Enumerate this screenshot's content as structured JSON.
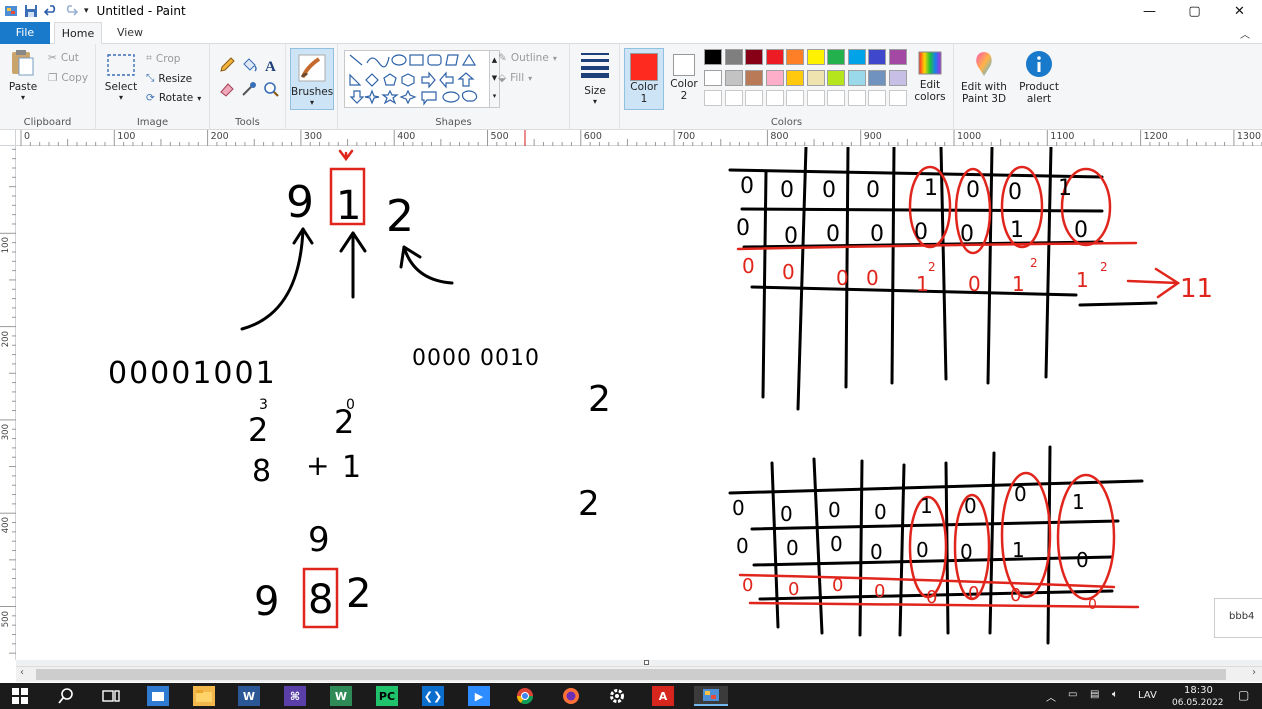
{
  "window": {
    "title": "Untitled - Paint",
    "buttons": [
      "—",
      "▢",
      "✕"
    ]
  },
  "tabs": {
    "file": "File",
    "home": "Home",
    "view": "View"
  },
  "ribbon": {
    "clipboard": {
      "paste": "Paste",
      "cut": "Cut",
      "copy": "Copy",
      "label": "Clipboard"
    },
    "image": {
      "select": "Select",
      "crop": "Crop",
      "resize": "Resize",
      "rotate": "Rotate",
      "label": "Image"
    },
    "tools": {
      "label": "Tools"
    },
    "brushes": {
      "label": "Brushes"
    },
    "shapes": {
      "outline": "Outline",
      "fill": "Fill",
      "label": "Shapes"
    },
    "size": {
      "label": "Size"
    },
    "colors": {
      "color1_label": "Color\n1",
      "color1_a": "Color",
      "color1_b": "1",
      "color2_a": "Color",
      "color2_b": "2",
      "color1": "#ff2a1f",
      "color2": "#ffffff",
      "label": "Colors",
      "edit_colors_a": "Edit",
      "edit_colors_b": "colors",
      "palette_row1": [
        "#000000",
        "#7f7f7f",
        "#880015",
        "#ed1c24",
        "#ff7f27",
        "#fff200",
        "#22b14c",
        "#00a2e8",
        "#3f48cc",
        "#a349a4"
      ],
      "palette_row2": [
        "#ffffff",
        "#c3c3c3",
        "#b97a57",
        "#ffaec9",
        "#ffc90e",
        "#efe4b0",
        "#b5e61d",
        "#99d9ea",
        "#7092be",
        "#c8bfe7"
      ]
    },
    "paint3d": {
      "line1": "Edit with",
      "line2": "Paint 3D"
    },
    "product_alert": {
      "line1": "Product",
      "line2": "alert"
    }
  },
  "ruler": {
    "top_ticks": [
      "0",
      "100",
      "200",
      "300",
      "400",
      "500",
      "600",
      "700",
      "800",
      "900",
      "1000",
      "1100",
      "1200",
      "1300"
    ],
    "left_ticks": [
      "100",
      "200",
      "300",
      "400",
      "500"
    ]
  },
  "canvas_text": {
    "top_digits": [
      "9",
      "1",
      "2"
    ],
    "binary_left": "00001001",
    "binary_right": "0000 0010",
    "pow_3": "3",
    "pow_0": "0",
    "two_a": "2",
    "two_b": "2",
    "eight": "8",
    "plus": "+",
    "one": "1",
    "nine": "9",
    "right_two_a": "2",
    "right_two_b": "2",
    "bottom_digits": [
      "9",
      "8",
      "2"
    ],
    "table1_row1": [
      "0",
      "0",
      "0",
      "0",
      "1",
      "0",
      "0",
      "1"
    ],
    "table1_row2": [
      "0",
      "0",
      "0",
      "0",
      "0",
      "0",
      "1",
      "0"
    ],
    "table1_row3": [
      "0",
      "0",
      "0",
      "0",
      "1",
      "0",
      "1",
      "1"
    ],
    "sup2": "2",
    "arrow_result": "11",
    "table2_row1": [
      "0",
      "0",
      "0",
      "0",
      "1",
      "0",
      "0",
      "1"
    ],
    "table2_row2": [
      "0",
      "0",
      "0",
      "0",
      "0",
      "0",
      "1",
      "0"
    ],
    "table2_row3": [
      "0",
      "0",
      "0",
      "0",
      "0",
      "0",
      "0",
      "0"
    ]
  },
  "side_popup": "bbb4",
  "taskbar": {
    "lang": "LAV",
    "time": "18:30",
    "date": "06.05.2022"
  }
}
